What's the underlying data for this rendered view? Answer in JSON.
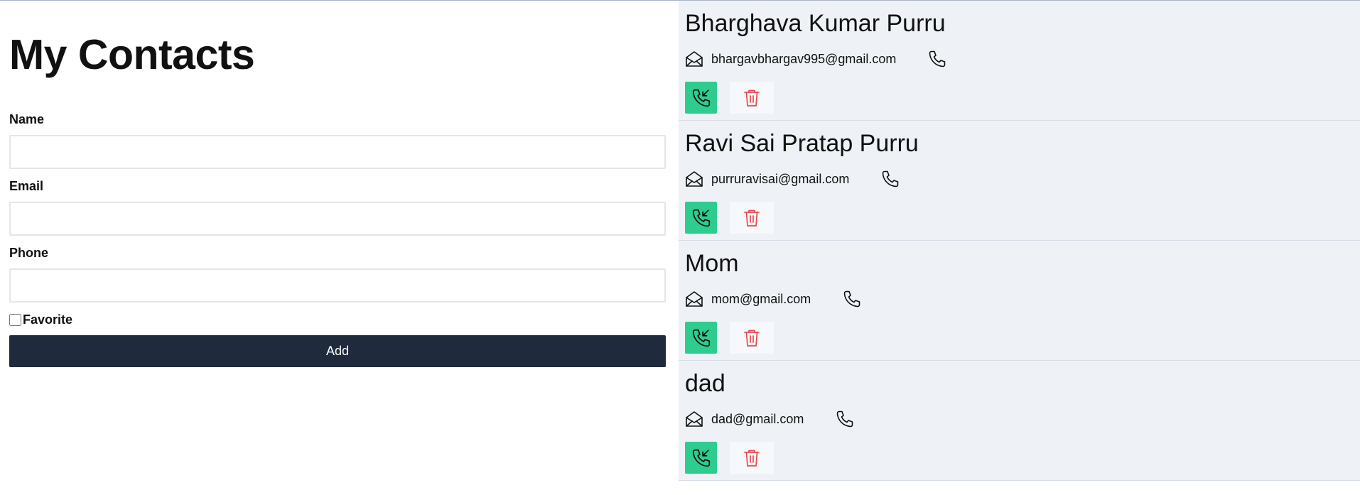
{
  "page": {
    "title": "My Contacts"
  },
  "form": {
    "name_label": "Name",
    "name_value": "",
    "email_label": "Email",
    "email_value": "",
    "phone_label": "Phone",
    "phone_value": "",
    "favorite_label": "Favorite",
    "favorite_checked": false,
    "add_label": "Add"
  },
  "contacts": [
    {
      "name": "Bharghava Kumar Purru",
      "email": "bhargavbhargav995@gmail.com"
    },
    {
      "name": "Ravi Sai Pratap Purru",
      "email": "purruravisai@gmail.com"
    },
    {
      "name": "Mom",
      "email": "mom@gmail.com"
    },
    {
      "name": "dad",
      "email": "dad@gmail.com"
    }
  ],
  "icons": {
    "mail": "envelope-open-icon",
    "phone": "phone-icon",
    "call": "phone-incoming-icon",
    "delete": "trash-icon"
  },
  "colors": {
    "add_button": "#1f2a3c",
    "call_button": "#2ecc8f",
    "delete_icon": "#e5484d",
    "list_background": "#eef2f7"
  }
}
